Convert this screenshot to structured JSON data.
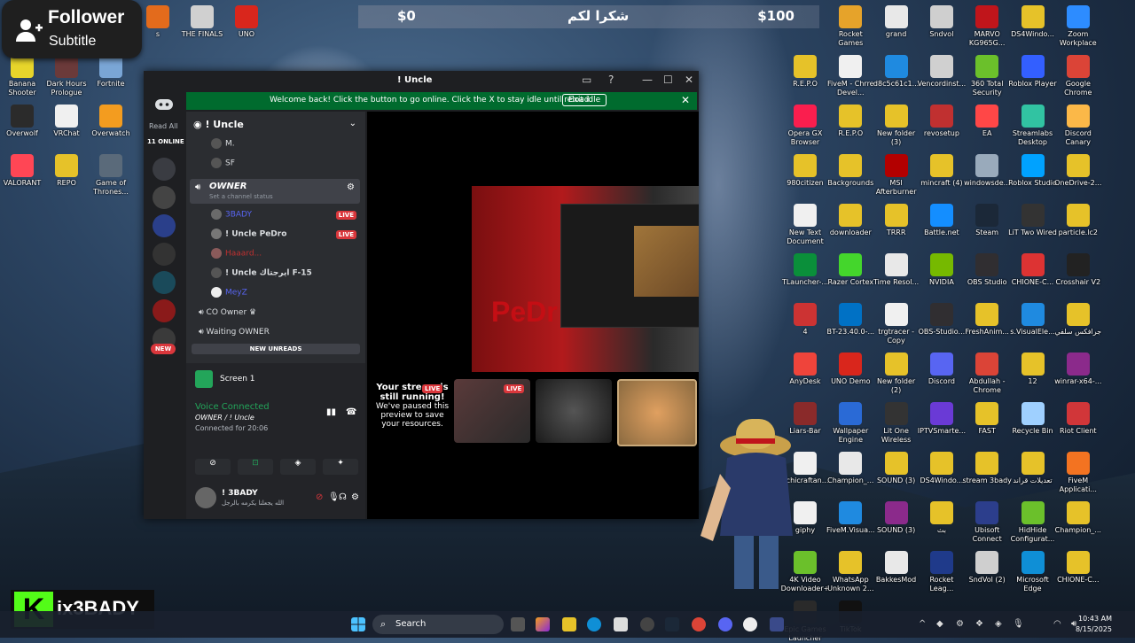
{
  "overlay": {
    "follower_title": "Follower",
    "follower_subtitle": "Subtitle",
    "brand_name": "ix3BADY",
    "brand_logo": "K"
  },
  "donation_bar": {
    "left_amount": "$0",
    "middle_text": "شكرا لكم",
    "right_amount": "$100"
  },
  "desktop_icons_left": [
    {
      "label": "s",
      "color": "#e36b1c"
    },
    {
      "label": "THE FINALS",
      "color": "#d0d0d0"
    },
    {
      "label": "UNO",
      "color": "#d9261c"
    },
    {
      "label": "Banana Shooter",
      "color": "#e7d52b"
    },
    {
      "label": "Dark Hours Prologue",
      "color": "#6b3a3a"
    },
    {
      "label": "Fortnite",
      "color": "#7aa6d6"
    },
    {
      "label": "Overwolf",
      "color": "#2b2b2b"
    },
    {
      "label": "VRChat",
      "color": "#f0f0f0"
    },
    {
      "label": "Overwatch",
      "color": "#f39c1f"
    },
    {
      "label": "VALORANT",
      "color": "#ff4655"
    },
    {
      "label": "REPO",
      "color": "#e6c229"
    },
    {
      "label": "Game of Thrones...",
      "color": "#5a6a7a"
    }
  ],
  "desktop_icons_right": [
    {
      "label": "Rocket Games",
      "color": "#e6a32a"
    },
    {
      "label": "grand",
      "color": "#e8e8e8"
    },
    {
      "label": "Sndvol",
      "color": "#cfcfcf"
    },
    {
      "label": "MARVO KG965G...",
      "color": "#c0151b"
    },
    {
      "label": "DS4Windo...",
      "color": "#e6c229"
    },
    {
      "label": "Zoom Workplace",
      "color": "#2d8cff"
    },
    {
      "label": "R.E.P.O",
      "color": "#e6c229"
    },
    {
      "label": "FiveM - Chrre Devel...",
      "color": "#f0f0f0"
    },
    {
      "label": "d8c5c61c1...",
      "color": "#1f8ae0"
    },
    {
      "label": "Vencordinst...",
      "color": "#d0d0d0"
    },
    {
      "label": "360 Total Security",
      "color": "#6bc02b"
    },
    {
      "label": "Roblox Player",
      "color": "#335fff"
    },
    {
      "label": "Google Chrome",
      "color": "#db4437"
    },
    {
      "label": "Opera GX Browser",
      "color": "#fa1e4e"
    },
    {
      "label": "R.E.P.O",
      "color": "#e6c229"
    },
    {
      "label": "New folder (3)",
      "color": "#e6c229"
    },
    {
      "label": "revosetup",
      "color": "#c03030"
    },
    {
      "label": "EA",
      "color": "#ff4747"
    },
    {
      "label": "Streamlabs Desktop",
      "color": "#31c3a2"
    },
    {
      "label": "Discord Canary",
      "color": "#fbb848"
    },
    {
      "label": "980citizen",
      "color": "#e6c229"
    },
    {
      "label": "Backgrounds",
      "color": "#e6c229"
    },
    {
      "label": "MSI Afterburner",
      "color": "#b30000"
    },
    {
      "label": "mincraft (4)",
      "color": "#e6c229"
    },
    {
      "label": "windowsde...",
      "color": "#9ab"
    },
    {
      "label": "Roblox Studio",
      "color": "#00a2ff"
    },
    {
      "label": "OneDrive-2...",
      "color": "#e6c229"
    },
    {
      "label": "New Text Document",
      "color": "#f0f0f0"
    },
    {
      "label": "downloader",
      "color": "#e6c229"
    },
    {
      "label": "TRRR",
      "color": "#e6c229"
    },
    {
      "label": "Battle.net",
      "color": "#148eff"
    },
    {
      "label": "Steam",
      "color": "#1b2838"
    },
    {
      "label": "LiT Two Wired",
      "color": "#333"
    },
    {
      "label": "particle.lc2",
      "color": "#e6c229"
    },
    {
      "label": "TLauncher-...",
      "color": "#0a8f3a"
    },
    {
      "label": "Razer Cortex",
      "color": "#44d62c"
    },
    {
      "label": "Time Resol...",
      "color": "#e8e8e8"
    },
    {
      "label": "NVIDIA",
      "color": "#76b900"
    },
    {
      "label": "OBS Studio",
      "color": "#302e31"
    },
    {
      "label": "CHIONE-C...",
      "color": "#d33"
    },
    {
      "label": "Crosshair V2",
      "color": "#222"
    },
    {
      "label": "4",
      "color": "#c33"
    },
    {
      "label": "BT-23.40.0-...",
      "color": "#0071c5"
    },
    {
      "label": "trgtracer - Copy",
      "color": "#f0f0f0"
    },
    {
      "label": "OBS-Studio...",
      "color": "#302e31"
    },
    {
      "label": "FreshAnim...",
      "color": "#e6c229"
    },
    {
      "label": "s.VisualEle...",
      "color": "#1f8ae0"
    },
    {
      "label": "جرافكس سلفي",
      "color": "#e6c229"
    },
    {
      "label": "AnyDesk",
      "color": "#ef443b"
    },
    {
      "label": "UNO Demo",
      "color": "#d9261c"
    },
    {
      "label": "New folder (2)",
      "color": "#e6c229"
    },
    {
      "label": "Discord",
      "color": "#5865f2"
    },
    {
      "label": "Abdullah - Chrome",
      "color": "#db4437"
    },
    {
      "label": "12",
      "color": "#e6c229"
    },
    {
      "label": "winrar-x64-...",
      "color": "#8b2a8b"
    },
    {
      "label": "Liars-Bar",
      "color": "#8a2a2a"
    },
    {
      "label": "Wallpaper Engine",
      "color": "#2a6ad6"
    },
    {
      "label": "Lit One Wireless",
      "color": "#333"
    },
    {
      "label": "IPTVSmarte...",
      "color": "#6a3ad6"
    },
    {
      "label": "FAST",
      "color": "#e6c229"
    },
    {
      "label": "Recycle Bin",
      "color": "#9fd0ff"
    },
    {
      "label": "Riot Client",
      "color": "#d13639"
    },
    {
      "label": "uchicraftan...",
      "color": "#f0f0f0"
    },
    {
      "label": "Champion_...",
      "color": "#e8e8e8"
    },
    {
      "label": "SOUND (3)",
      "color": "#e6c229"
    },
    {
      "label": "DS4Windo...",
      "color": "#e6c229"
    },
    {
      "label": "stream 3bady",
      "color": "#e6c229"
    },
    {
      "label": "تعديلات قراند",
      "color": "#e6c229"
    },
    {
      "label": "FiveM Applicati...",
      "color": "#f37321"
    },
    {
      "label": "giphy",
      "color": "#f0f0f0"
    },
    {
      "label": "FiveM.Visua...",
      "color": "#1f8ae0"
    },
    {
      "label": "SOUND (3)",
      "color": "#8b2a8b"
    },
    {
      "label": "بث",
      "color": "#e6c229"
    },
    {
      "label": "Ubisoft Connect",
      "color": "#2c3e8c"
    },
    {
      "label": "HidHide Configurat...",
      "color": "#6bc02b"
    },
    {
      "label": "Champion_...",
      "color": "#e6c229"
    },
    {
      "label": "4K Video Downloader+",
      "color": "#6bc02b"
    },
    {
      "label": "WhatsApp Unknown 2...",
      "color": "#e6c229"
    },
    {
      "label": "BakkesMod",
      "color": "#e8e8e8"
    },
    {
      "label": "Rocket Leag...",
      "color": "#1f3a8a"
    },
    {
      "label": "SndVol (2)",
      "color": "#cfcfcf"
    },
    {
      "label": "Microsoft Edge",
      "color": "#0f8fd6"
    },
    {
      "label": "CHIONE-C...",
      "color": "#e6c229"
    },
    {
      "label": "Epic Games Launcher",
      "color": "#2a2a2a"
    },
    {
      "label": "TikTok",
      "color": "#111"
    }
  ],
  "discord": {
    "window_title": "! Uncle",
    "banner_message": "Welcome back! Click the button to go online. Click the X to stay idle until reload.",
    "banner_button": "Exit idle",
    "read_all": "Read All",
    "online_count": "11 ONLINE",
    "server_name": "! Uncle",
    "voice_channel_owner": "OWNER",
    "channel_status": "Set a channel status",
    "users": [
      {
        "name": "3BADY",
        "live": true
      },
      {
        "name": "! Uncle PeDro",
        "live": true
      },
      {
        "name": "Haaard...",
        "live": false
      },
      {
        "name": "! Uncle ايرجتاك F-15",
        "live": false
      },
      {
        "name": "MeyZ",
        "live": false
      }
    ],
    "top_users": [
      {
        "name": "M."
      },
      {
        "name": "SF"
      }
    ],
    "co_owner": "CO Owner",
    "waiting_owner": "Waiting OWNER",
    "new_unreads": "NEW UNREADS",
    "new_badge": "NEW",
    "live_label": "LIVE",
    "screen_share": "Screen 1",
    "voice_connected": "Voice Connected",
    "voice_channel_path": "OWNER / ! Uncle",
    "connected_time": "Connected for 20:06",
    "current_user": "! 3BADY",
    "current_user_status": "الله يجعلنا يكرمه بالرجل",
    "stream_preview_text": "PeDr",
    "paused_title": "Your stream is still running!",
    "paused_body": "We've paused this preview to save your resources."
  },
  "taskbar": {
    "search_label": "Search",
    "time": "10:43 AM",
    "date": "8/15/2025"
  }
}
